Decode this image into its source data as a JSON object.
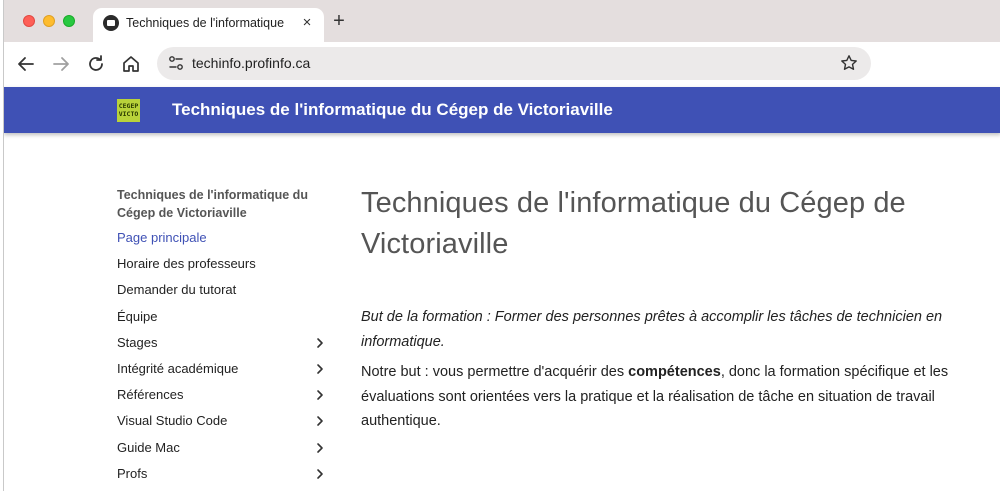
{
  "browser": {
    "tab": {
      "title": "Techniques de l'informatique",
      "close_glyph": "×"
    },
    "new_tab_glyph": "+",
    "url": "techinfo.profinfo.ca",
    "icons": [
      "back-icon",
      "forward-icon",
      "reload-icon",
      "home-icon",
      "site-info-icon",
      "star-icon"
    ]
  },
  "header": {
    "logo_text": "CEGEP VICTO",
    "title": "Techniques de l'informatique du Cégep de Victoriaville"
  },
  "sidebar": {
    "heading": "Techniques de l'informatique du Cégep de Victoriaville",
    "items": [
      {
        "label": "Page principale",
        "active": true,
        "expandable": false
      },
      {
        "label": "Horaire des professeurs",
        "active": false,
        "expandable": false
      },
      {
        "label": "Demander du tutorat",
        "active": false,
        "expandable": false
      },
      {
        "label": "Équipe",
        "active": false,
        "expandable": false
      },
      {
        "label": "Stages",
        "active": false,
        "expandable": true
      },
      {
        "label": "Intégrité académique",
        "active": false,
        "expandable": true
      },
      {
        "label": "Références",
        "active": false,
        "expandable": true
      },
      {
        "label": "Visual Studio Code",
        "active": false,
        "expandable": true
      },
      {
        "label": "Guide Mac",
        "active": false,
        "expandable": true
      },
      {
        "label": "Profs",
        "active": false,
        "expandable": true
      }
    ]
  },
  "main": {
    "title": "Techniques de l'informatique du Cégep de Victoriaville",
    "goal": "But de la formation : Former des personnes prêtes à accomplir les tâches de technicien en informatique.",
    "para_before": "Notre but : vous permettre d'acquérir des ",
    "para_bold": "compétences",
    "para_after": ", donc la formation spécifique et les évaluations sont orientées vers la pratique et la réalisation de tâche en situation de travail authentique."
  },
  "colors": {
    "header_bg": "#3f51b5",
    "active_link": "#3f51b5",
    "logo_bg": "#b9d23a"
  }
}
